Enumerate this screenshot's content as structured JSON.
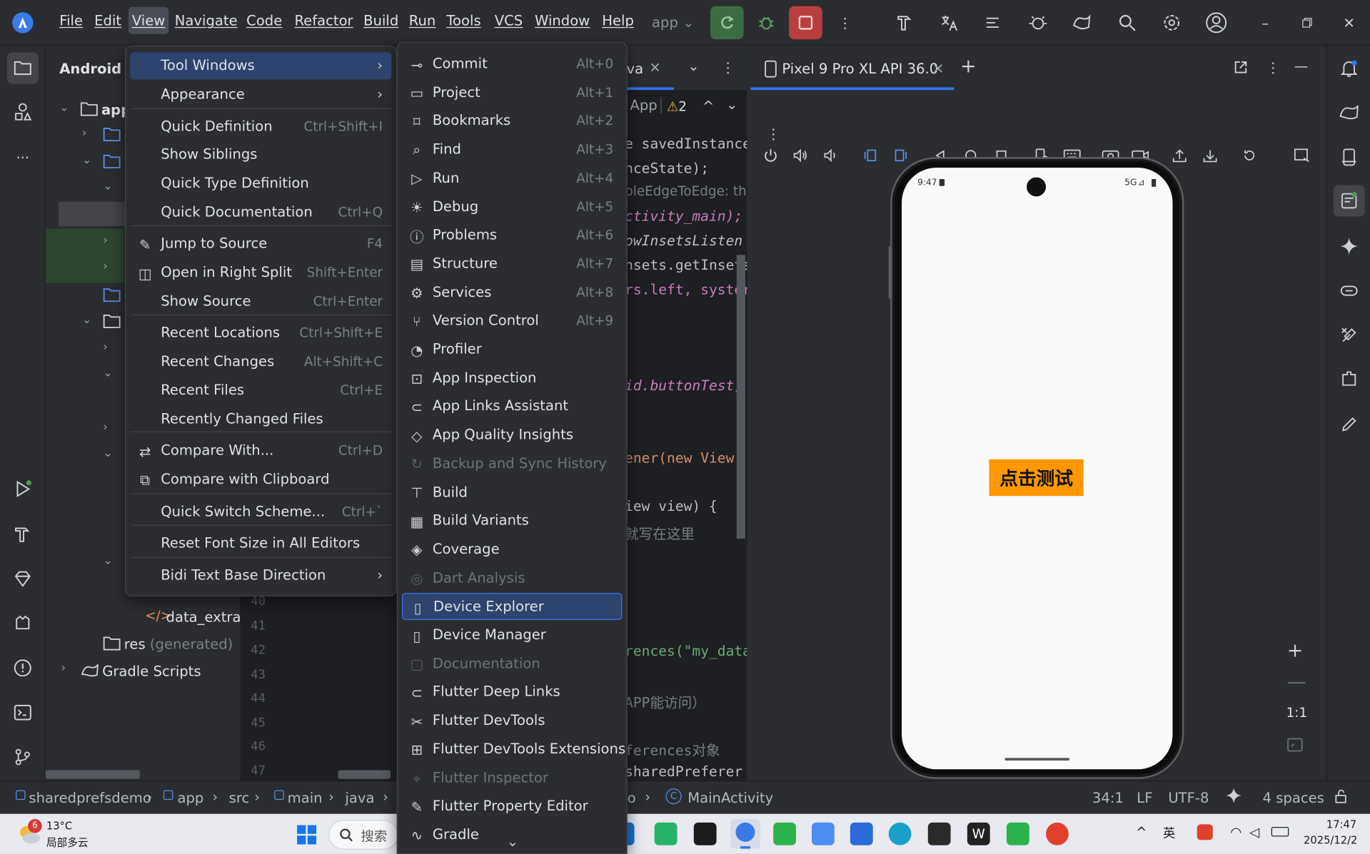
{
  "titlebar": {
    "menus": [
      "File",
      "Edit",
      "View",
      "Navigate",
      "Code",
      "Refactor",
      "Build",
      "Run",
      "Tools",
      "VCS",
      "Window",
      "Help"
    ],
    "run_config": "app"
  },
  "project": {
    "view_name": "Android",
    "root": "app",
    "data_extract": "data_extract",
    "res_generated": "res",
    "res_generated_suffix": "(generated)",
    "gradle_scripts": "Gradle Scripts"
  },
  "editor": {
    "tab_label": "va",
    "breadcrumb_app": "App",
    "warnings": "2",
    "line_numbers": [
      "40",
      "41",
      "42",
      "43",
      "44",
      "45",
      "46",
      "47"
    ],
    "code_lines": [
      "e savedInstance",
      "nceState);",
      "bleEdgeToEdge: th",
      "ctivity_main);",
      "owInsetsListen",
      "nsets.getInsets",
      "rs.left, syster",
      "id.buttonTest)",
      "ener(new View.",
      "iew view) {",
      "就写在这里",
      "rences(\"my_data",
      "APP能访问）",
      "ferences对象",
      "sharedPreferer"
    ]
  },
  "view_menu": {
    "items": [
      {
        "label": "Tool Windows",
        "submenu": true,
        "selected": true
      },
      {
        "label": "Appearance",
        "submenu": true
      },
      {
        "label": "Quick Definition",
        "shortcut": "Ctrl+Shift+I"
      },
      {
        "label": "Show Siblings"
      },
      {
        "label": "Quick Type Definition"
      },
      {
        "label": "Quick Documentation",
        "shortcut": "Ctrl+Q"
      },
      {
        "label": "Jump to Source",
        "shortcut": "F4"
      },
      {
        "label": "Open in Right Split",
        "shortcut": "Shift+Enter"
      },
      {
        "label": "Show Source",
        "shortcut": "Ctrl+Enter"
      },
      {
        "label": "Recent Locations",
        "shortcut": "Ctrl+Shift+E"
      },
      {
        "label": "Recent Changes",
        "shortcut": "Alt+Shift+C"
      },
      {
        "label": "Recent Files",
        "shortcut": "Ctrl+E"
      },
      {
        "label": "Recently Changed Files"
      },
      {
        "label": "Compare With...",
        "shortcut": "Ctrl+D"
      },
      {
        "label": "Compare with Clipboard"
      },
      {
        "label": "Quick Switch Scheme...",
        "shortcut": "Ctrl+`"
      },
      {
        "label": "Reset Font Size in All Editors"
      },
      {
        "label": "Bidi Text Base Direction",
        "submenu": true
      }
    ]
  },
  "tool_windows": {
    "items": [
      {
        "label": "Commit",
        "shortcut": "Alt+0",
        "icon": "commit-icon"
      },
      {
        "label": "Project",
        "shortcut": "Alt+1",
        "icon": "folder-icon"
      },
      {
        "label": "Bookmarks",
        "shortcut": "Alt+2",
        "icon": "bookmark-icon"
      },
      {
        "label": "Find",
        "shortcut": "Alt+3",
        "icon": "search-icon"
      },
      {
        "label": "Run",
        "shortcut": "Alt+4",
        "icon": "run-icon"
      },
      {
        "label": "Debug",
        "shortcut": "Alt+5",
        "icon": "bug-icon"
      },
      {
        "label": "Problems",
        "shortcut": "Alt+6",
        "icon": "problems-icon"
      },
      {
        "label": "Structure",
        "shortcut": "Alt+7",
        "icon": "structure-icon"
      },
      {
        "label": "Services",
        "shortcut": "Alt+8",
        "icon": "services-icon"
      },
      {
        "label": "Version Control",
        "shortcut": "Alt+9",
        "icon": "vcs-icon"
      },
      {
        "label": "Profiler",
        "icon": "profiler-icon"
      },
      {
        "label": "App Inspection",
        "icon": "inspection-icon"
      },
      {
        "label": "App Links Assistant",
        "icon": "links-icon"
      },
      {
        "label": "App Quality Insights",
        "icon": "diamond-icon"
      },
      {
        "label": "Backup and Sync History",
        "icon": "sync-icon",
        "disabled": true
      },
      {
        "label": "Build",
        "icon": "hammer-icon"
      },
      {
        "label": "Build Variants",
        "icon": "build-variants-icon"
      },
      {
        "label": "Coverage",
        "icon": "shield-icon"
      },
      {
        "label": "Dart Analysis",
        "icon": "dart-icon",
        "disabled": true
      },
      {
        "label": "Device Explorer",
        "icon": "device-explorer-icon",
        "selected": true
      },
      {
        "label": "Device Manager",
        "icon": "phone-icon"
      },
      {
        "label": "Documentation",
        "icon": "doc-icon",
        "disabled": true
      },
      {
        "label": "Flutter Deep Links",
        "icon": "links-icon"
      },
      {
        "label": "Flutter DevTools",
        "icon": "devtools-icon"
      },
      {
        "label": "Flutter DevTools Extensions",
        "icon": "extension-icon"
      },
      {
        "label": "Flutter Inspector",
        "icon": "inspector-icon",
        "disabled": true
      },
      {
        "label": "Flutter Property Editor",
        "icon": "pencil-icon"
      },
      {
        "label": "Gradle",
        "icon": "gradle-icon"
      }
    ]
  },
  "device": {
    "tab_title": "Pixel 9 Pro XL API 36.0",
    "status_time": "9:47",
    "status_net": "5G",
    "button_text": "点击测试",
    "zoom_label": "1:1",
    "button_color": "#ff9800"
  },
  "statusbar": {
    "crumbs": [
      "sharedprefsdemo",
      "app",
      "src",
      "main",
      "java"
    ],
    "crumb_tail": "o",
    "class_name": "MainActivity",
    "position": "34:1",
    "line_sep": "LF",
    "encoding": "UTF-8",
    "indent": "4 spaces"
  },
  "taskbar": {
    "weather_temp": "13°C",
    "weather_desc": "局部多云",
    "weather_badge": "6",
    "search_label": "搜索",
    "ime": "英",
    "time": "17:47",
    "date": "2025/12/2"
  },
  "colors": {
    "accent": "#3574f0",
    "run_green": "#57965c",
    "stop_red": "#c94f4f"
  }
}
